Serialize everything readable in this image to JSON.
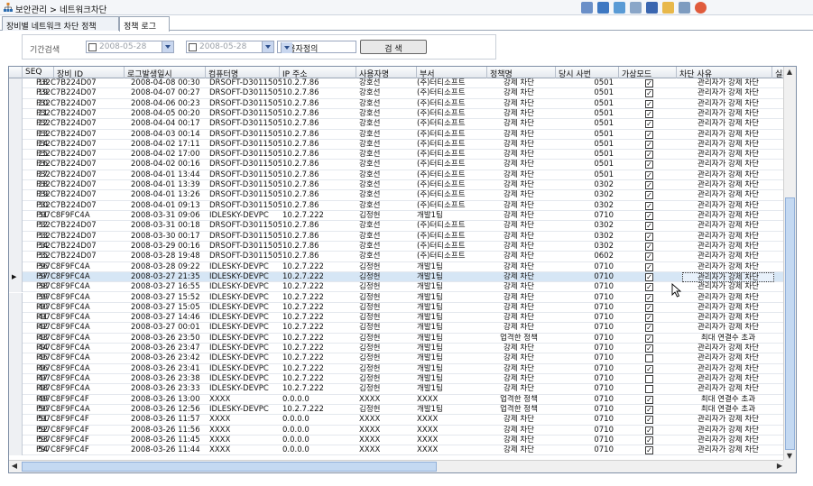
{
  "window": {
    "breadcrumb": "보안관리 > 네트워크차단"
  },
  "tabs": [
    {
      "label": "장비별 네트워크 차단 정책"
    },
    {
      "label": "정책 로그"
    }
  ],
  "filter": {
    "label": "기간검색",
    "from_date": "2008-05-28",
    "tilde": "~",
    "to_date": "2008-05-28",
    "select_value": "사용자정의",
    "search_label": "검 색"
  },
  "grid": {
    "columns": [
      "SEQ",
      "장비 ID",
      "로그발생일시",
      "컴퓨터명",
      "IP 주소",
      "사용자명",
      "부서",
      "정책명",
      "당시 사번",
      "가상모드",
      "차단 사유",
      "실제"
    ],
    "rows": [
      {
        "seq": "18",
        "id": "P32C7B224D07",
        "time": "2008-04-08 00:30",
        "pc": "DRSOFT-D3011505",
        "ip": "10.2.7.86",
        "user": "강호선",
        "dept": "(주)터티소프트",
        "policy": "강제 차단",
        "emp": "0501",
        "vm": true,
        "reason": "관리자가 강제 차단"
      },
      {
        "seq": "19",
        "id": "P32C7B224D07",
        "time": "2008-04-07 00:27",
        "pc": "DRSOFT-D3011505",
        "ip": "10.2.7.86",
        "user": "강호선",
        "dept": "(주)터티소프트",
        "policy": "강제 차단",
        "emp": "0501",
        "vm": true,
        "reason": "관리자가 강제 차단"
      },
      {
        "seq": "20",
        "id": "P32C7B224D07",
        "time": "2008-04-06 00:23",
        "pc": "DRSOFT-D3011505",
        "ip": "10.2.7.86",
        "user": "강호선",
        "dept": "(주)터티소프트",
        "policy": "강제 차단",
        "emp": "0501",
        "vm": true,
        "reason": "관리자가 강제 차단"
      },
      {
        "seq": "21",
        "id": "P32C7B224D07",
        "time": "2008-04-05 00:20",
        "pc": "DRSOFT-D3011505",
        "ip": "10.2.7.86",
        "user": "강호선",
        "dept": "(주)터티소프트",
        "policy": "강제 차단",
        "emp": "0501",
        "vm": true,
        "reason": "관리자가 강제 차단"
      },
      {
        "seq": "22",
        "id": "P32C7B224D07",
        "time": "2008-04-04 00:17",
        "pc": "DRSOFT-D3011505",
        "ip": "10.2.7.86",
        "user": "강호선",
        "dept": "(주)터티소프트",
        "policy": "강제 차단",
        "emp": "0501",
        "vm": true,
        "reason": "관리자가 강제 차단"
      },
      {
        "seq": "23",
        "id": "P32C7B224D07",
        "time": "2008-04-03 00:14",
        "pc": "DRSOFT-D3011505",
        "ip": "10.2.7.86",
        "user": "강호선",
        "dept": "(주)터티소프트",
        "policy": "강제 차단",
        "emp": "0501",
        "vm": true,
        "reason": "관리자가 강제 차단"
      },
      {
        "seq": "24",
        "id": "P32C7B224D07",
        "time": "2008-04-02 17:11",
        "pc": "DRSOFT-D3011505",
        "ip": "10.2.7.86",
        "user": "강호선",
        "dept": "(주)터티소프트",
        "policy": "강제 차단",
        "emp": "0501",
        "vm": true,
        "reason": "관리자가 강제 차단"
      },
      {
        "seq": "25",
        "id": "P32C7B224D07",
        "time": "2008-04-02 17:00",
        "pc": "DRSOFT-D3011505",
        "ip": "10.2.7.86",
        "user": "강호선",
        "dept": "(주)터티소프트",
        "policy": "강제 차단",
        "emp": "0501",
        "vm": true,
        "reason": "관리자가 강제 차단"
      },
      {
        "seq": "26",
        "id": "P32C7B224D07",
        "time": "2008-04-02 00:16",
        "pc": "DRSOFT-D3011505",
        "ip": "10.2.7.86",
        "user": "강호선",
        "dept": "(주)터티소프트",
        "policy": "강제 차단",
        "emp": "0501",
        "vm": true,
        "reason": "관리자가 강제 차단"
      },
      {
        "seq": "27",
        "id": "P32C7B224D07",
        "time": "2008-04-01 13:44",
        "pc": "DRSOFT-D3011505",
        "ip": "10.2.7.86",
        "user": "강호선",
        "dept": "(주)터티소프트",
        "policy": "강제 차단",
        "emp": "0501",
        "vm": true,
        "reason": "관리자가 강제 차단"
      },
      {
        "seq": "28",
        "id": "P32C7B224D07",
        "time": "2008-04-01 13:39",
        "pc": "DRSOFT-D3011505",
        "ip": "10.2.7.86",
        "user": "강호선",
        "dept": "(주)터티소프트",
        "policy": "강제 차단",
        "emp": "0302",
        "vm": true,
        "reason": "관리자가 강제 차단"
      },
      {
        "seq": "29",
        "id": "P32C7B224D07",
        "time": "2008-04-01 13:26",
        "pc": "DRSOFT-D3011505",
        "ip": "10.2.7.86",
        "user": "강호선",
        "dept": "(주)터티소프트",
        "policy": "강제 차단",
        "emp": "0302",
        "vm": true,
        "reason": "관리자가 강제 차단"
      },
      {
        "seq": "30",
        "id": "P32C7B224D07",
        "time": "2008-04-01 09:13",
        "pc": "DRSOFT-D3011505",
        "ip": "10.2.7.86",
        "user": "강호선",
        "dept": "(주)터티소프트",
        "policy": "강제 차단",
        "emp": "0302",
        "vm": true,
        "reason": "관리자가 강제 차단"
      },
      {
        "seq": "31",
        "id": "P97C8F9FC4A",
        "time": "2008-03-31 09:06",
        "pc": "IDLESKY-DEVPC",
        "ip": "10.2.7.222",
        "user": "김정헌",
        "dept": "개발1팀",
        "policy": "강제 차단",
        "emp": "0710",
        "vm": true,
        "reason": "관리자가 강제 차단"
      },
      {
        "seq": "32",
        "id": "P32C7B224D07",
        "time": "2008-03-31 00:18",
        "pc": "DRSOFT-D3011505",
        "ip": "10.2.7.86",
        "user": "강호선",
        "dept": "(주)터티소프트",
        "policy": "강제 차단",
        "emp": "0302",
        "vm": true,
        "reason": "관리자가 강제 차단"
      },
      {
        "seq": "33",
        "id": "P32C7B224D07",
        "time": "2008-03-30 00:17",
        "pc": "DRSOFT-D3011505",
        "ip": "10.2.7.86",
        "user": "강호선",
        "dept": "(주)터티소프트",
        "policy": "강제 차단",
        "emp": "0302",
        "vm": true,
        "reason": "관리자가 강제 차단"
      },
      {
        "seq": "34",
        "id": "P32C7B224D07",
        "time": "2008-03-29 00:16",
        "pc": "DRSOFT-D3011505",
        "ip": "10.2.7.86",
        "user": "강호선",
        "dept": "(주)터티소프트",
        "policy": "강제 차단",
        "emp": "0302",
        "vm": true,
        "reason": "관리자가 강제 차단"
      },
      {
        "seq": "35",
        "id": "P32C7B224D07",
        "time": "2008-03-28 19:48",
        "pc": "DRSOFT-D3011505",
        "ip": "10.2.7.86",
        "user": "강호선",
        "dept": "(주)터티소프트",
        "policy": "강제 차단",
        "emp": "0602",
        "vm": true,
        "reason": "관리자가 강제 차단"
      },
      {
        "seq": "36",
        "id": "P97C8F9FC4A",
        "time": "2008-03-28 09:22",
        "pc": "IDLESKY-DEVPC",
        "ip": "10.2.7.222",
        "user": "김정헌",
        "dept": "개발1팀",
        "policy": "강제 차단",
        "emp": "0710",
        "vm": true,
        "reason": "관리자가 강제 차단"
      },
      {
        "seq": "37",
        "id": "P97C8F9FC4A",
        "time": "2008-03-27 21:35",
        "pc": "IDLESKY-DEVPC",
        "ip": "10.2.7.222",
        "user": "김정헌",
        "dept": "개발1팀",
        "policy": "강제 차단",
        "emp": "0710",
        "vm": true,
        "reason": "관리자가 강제 차단",
        "selected": true
      },
      {
        "seq": "38",
        "id": "P97C8F9FC4A",
        "time": "2008-03-27 16:55",
        "pc": "IDLESKY-DEVPC",
        "ip": "10.2.7.222",
        "user": "김정헌",
        "dept": "개발1팀",
        "policy": "강제 차단",
        "emp": "0710",
        "vm": true,
        "reason": "관리자가 강제 차단"
      },
      {
        "seq": "39",
        "id": "P97C8F9FC4A",
        "time": "2008-03-27 15:52",
        "pc": "IDLESKY-DEVPC",
        "ip": "10.2.7.222",
        "user": "김정헌",
        "dept": "개발1팀",
        "policy": "강제 차단",
        "emp": "0710",
        "vm": true,
        "reason": "관리자가 강제 차단"
      },
      {
        "seq": "40",
        "id": "P97C8F9FC4A",
        "time": "2008-03-27 15:05",
        "pc": "IDLESKY-DEVPC",
        "ip": "10.2.7.222",
        "user": "김정헌",
        "dept": "개발1팀",
        "policy": "강제 차단",
        "emp": "0710",
        "vm": true,
        "reason": "관리자가 강제 차단"
      },
      {
        "seq": "41",
        "id": "P97C8F9FC4A",
        "time": "2008-03-27 14:46",
        "pc": "IDLESKY-DEVPC",
        "ip": "10.2.7.222",
        "user": "김정헌",
        "dept": "개발1팀",
        "policy": "강제 차단",
        "emp": "0710",
        "vm": true,
        "reason": "관리자가 강제 차단"
      },
      {
        "seq": "42",
        "id": "P97C8F9FC4A",
        "time": "2008-03-27 00:01",
        "pc": "IDLESKY-DEVPC",
        "ip": "10.2.7.222",
        "user": "김정헌",
        "dept": "개발1팀",
        "policy": "강제 차단",
        "emp": "0710",
        "vm": true,
        "reason": "관리자가 강제 차단"
      },
      {
        "seq": "43",
        "id": "P97C8F9FC4A",
        "time": "2008-03-26 23:50",
        "pc": "IDLESKY-DEVPC",
        "ip": "10.2.7.222",
        "user": "김정헌",
        "dept": "개발1팀",
        "policy": "업격한 정책",
        "emp": "0710",
        "vm": true,
        "reason": "최대 연결수 초과"
      },
      {
        "seq": "44",
        "id": "P97C8F9FC4A",
        "time": "2008-03-26 23:47",
        "pc": "IDLESKY-DEVPC",
        "ip": "10.2.7.222",
        "user": "김정헌",
        "dept": "개발1팀",
        "policy": "강제 차단",
        "emp": "0710",
        "vm": true,
        "reason": "관리자가 강제 차단"
      },
      {
        "seq": "45",
        "id": "P97C8F9FC4A",
        "time": "2008-03-26 23:42",
        "pc": "IDLESKY-DEVPC",
        "ip": "10.2.7.222",
        "user": "김정헌",
        "dept": "개발1팀",
        "policy": "강제 차단",
        "emp": "0710",
        "vm": false,
        "reason": "관리자가 강제 차단"
      },
      {
        "seq": "46",
        "id": "P97C8F9FC4A",
        "time": "2008-03-26 23:41",
        "pc": "IDLESKY-DEVPC",
        "ip": "10.2.7.222",
        "user": "김정헌",
        "dept": "개발1팀",
        "policy": "강제 차단",
        "emp": "0710",
        "vm": true,
        "reason": "관리자가 강제 차단"
      },
      {
        "seq": "47",
        "id": "P97C8F9FC4A",
        "time": "2008-03-26 23:38",
        "pc": "IDLESKY-DEVPC",
        "ip": "10.2.7.222",
        "user": "김정헌",
        "dept": "개발1팀",
        "policy": "강제 차단",
        "emp": "0710",
        "vm": false,
        "reason": "관리자가 강제 차단"
      },
      {
        "seq": "48",
        "id": "P97C8F9FC4A",
        "time": "2008-03-26 23:33",
        "pc": "IDLESKY-DEVPC",
        "ip": "10.2.7.222",
        "user": "김정헌",
        "dept": "개발1팀",
        "policy": "강제 차단",
        "emp": "0710",
        "vm": false,
        "reason": "관리자가 강제 차단"
      },
      {
        "seq": "49",
        "id": "P97C8F9FC4F",
        "time": "2008-03-26 13:00",
        "pc": "XXXX",
        "ip": "0.0.0.0",
        "user": "XXXX",
        "dept": "XXXX",
        "policy": "업격한 정책",
        "emp": "0710",
        "vm": true,
        "reason": "최대 연결수 초과"
      },
      {
        "seq": "50",
        "id": "P97C8F9FC4A",
        "time": "2008-03-26 12:56",
        "pc": "IDLESKY-DEVPC",
        "ip": "10.2.7.222",
        "user": "김정헌",
        "dept": "개발1팀",
        "policy": "업격한 정책",
        "emp": "0710",
        "vm": true,
        "reason": "최대 연결수 초과"
      },
      {
        "seq": "51",
        "id": "P97C8F9FC4F",
        "time": "2008-03-26 11:57",
        "pc": "XXXX",
        "ip": "0.0.0.0",
        "user": "XXXX",
        "dept": "XXXX",
        "policy": "강제 차단",
        "emp": "0710",
        "vm": true,
        "reason": "관리자가 강제 차단"
      },
      {
        "seq": "52",
        "id": "P97C8F9FC4F",
        "time": "2008-03-26 11:56",
        "pc": "XXXX",
        "ip": "0.0.0.0",
        "user": "XXXX",
        "dept": "XXXX",
        "policy": "강제 차단",
        "emp": "0710",
        "vm": true,
        "reason": "관리자가 강제 차단"
      },
      {
        "seq": "53",
        "id": "P97C8F9FC4F",
        "time": "2008-03-26 11:45",
        "pc": "XXXX",
        "ip": "0.0.0.0",
        "user": "XXXX",
        "dept": "XXXX",
        "policy": "강제 차단",
        "emp": "0710",
        "vm": true,
        "reason": "관리자가 강제 차단"
      },
      {
        "seq": "54",
        "id": "P97C8F9FC4F",
        "time": "2008-03-26 11:44",
        "pc": "XXXX",
        "ip": "0.0.0.0",
        "user": "XXXX",
        "dept": "XXXX",
        "policy": "강제 차단",
        "emp": "0710",
        "vm": true,
        "reason": "관리자가 강제 차단"
      }
    ]
  },
  "icons": [
    "home-icon",
    "filter-icon",
    "export-icon",
    "print-icon",
    "save-icon",
    "mail-icon",
    "settings-icon",
    "close-icon"
  ],
  "colors": {
    "selected_row": "#d6e6f5",
    "header": "#e4e8ee",
    "scroll_thumb": "#c4d9f2"
  }
}
